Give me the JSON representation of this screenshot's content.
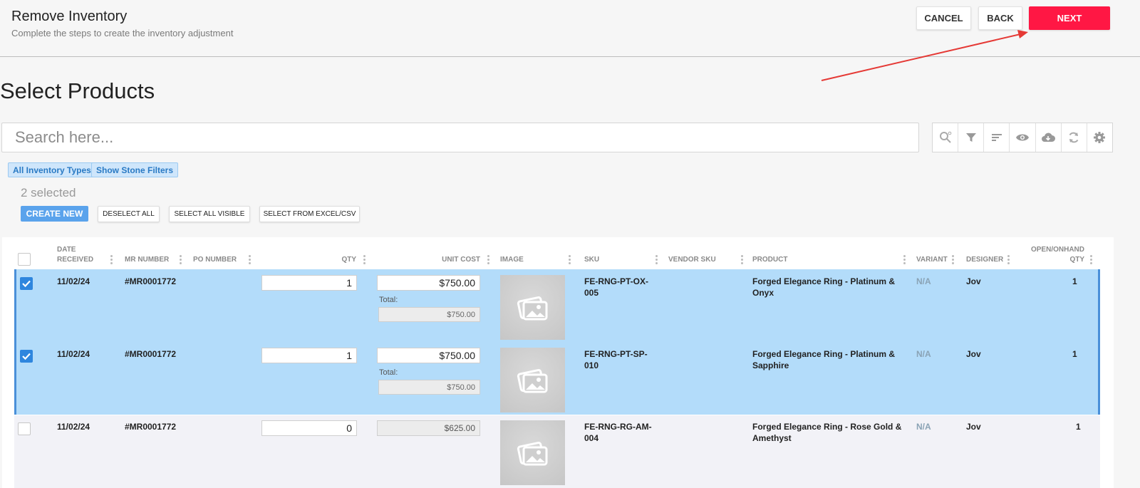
{
  "header": {
    "title": "Remove Inventory",
    "subtitle": "Complete the steps to create the inventory adjustment",
    "cancel_label": "CANCEL",
    "back_label": "BACK",
    "next_label": "NEXT",
    "next_color": "#ff1744"
  },
  "section": {
    "title": "Select Products"
  },
  "search": {
    "placeholder": "Search here..."
  },
  "toolbar": {
    "icons": [
      "search-settings-icon",
      "filter-icon",
      "sort-icon",
      "eye-icon",
      "cloud-download-icon",
      "refresh-icon",
      "gear-icon"
    ]
  },
  "filters": {
    "inventory_types": "All Inventory Types",
    "stone_filters": "Show Stone Filters"
  },
  "selection": {
    "count_text": "2 selected",
    "create_new": "CREATE NEW",
    "deselect_all": "DESELECT ALL",
    "select_all_visible": "SELECT ALL VISIBLE",
    "select_from_excel": "SELECT FROM EXCEL/CSV"
  },
  "table": {
    "columns": {
      "date_received_1": "DATE",
      "date_received_2": "RECEIVED",
      "mr_number": "MR NUMBER",
      "po_number": "PO NUMBER",
      "qty": "QTY",
      "unit_cost": "UNIT COST",
      "image": "IMAGE",
      "sku": "SKU",
      "vendor_sku": "VENDOR SKU",
      "product": "PRODUCT",
      "variant": "VARIANT",
      "designer": "DESIGNER",
      "open_onhand_1": "OPEN/ONHAND",
      "open_onhand_2": "QTY"
    },
    "total_label": "Total:",
    "rows": [
      {
        "selected": true,
        "date": "11/02/24",
        "mr_number": "#MR0001772",
        "qty": "1",
        "unit_cost": "$750.00",
        "total": "$750.00",
        "sku_1": "FE-RNG-PT-OX-",
        "sku_2": "005",
        "product_1": "Forged Elegance Ring - Platinum &",
        "product_2": "Onyx",
        "variant": "N/A",
        "designer": "Jov",
        "onhand": "1"
      },
      {
        "selected": true,
        "date": "11/02/24",
        "mr_number": "#MR0001772",
        "qty": "1",
        "unit_cost": "$750.00",
        "total": "$750.00",
        "sku_1": "FE-RNG-PT-SP-",
        "sku_2": "010",
        "product_1": "Forged Elegance Ring - Platinum &",
        "product_2": "Sapphire",
        "variant": "N/A",
        "designer": "Jov",
        "onhand": "1"
      },
      {
        "selected": false,
        "date": "11/02/24",
        "mr_number": "#MR0001772",
        "qty": "0",
        "unit_cost": "$625.00",
        "sku_1": "FE-RNG-RG-AM-",
        "sku_2": "004",
        "product_1": "Forged Elegance Ring - Rose Gold &",
        "product_2": "Amethyst",
        "variant": "N/A",
        "designer": "Jov",
        "onhand": "1"
      }
    ]
  }
}
